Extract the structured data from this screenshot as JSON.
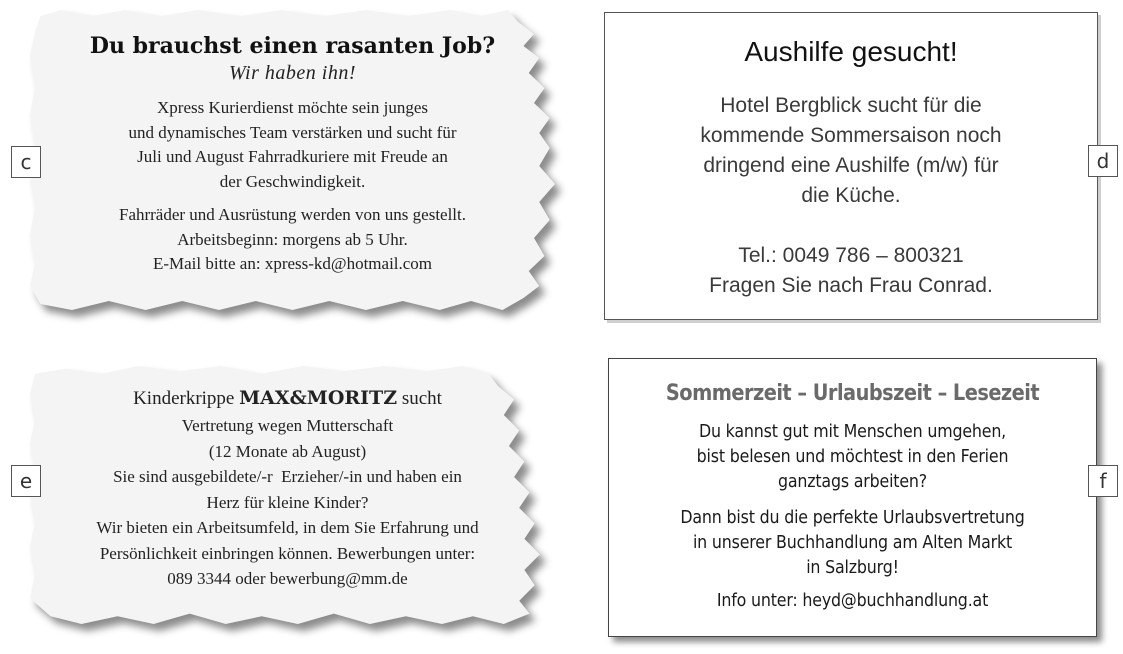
{
  "labels": {
    "c": "c",
    "d": "d",
    "e": "e",
    "f": "f"
  },
  "ad_c": {
    "title": "Du brauchst einen rasanten Job?",
    "subtitle": "Wir haben ihn!",
    "paragraph1": [
      "Xpress Kurierdienst möchte sein junges",
      "und dynamisches Team verstärken und sucht für",
      "Juli und August Fahrradkuriere mit Freude an",
      "der Geschwindigkeit."
    ],
    "paragraph2": [
      "Fahrräder und Ausrüstung werden von uns gestellt.",
      "Arbeitsbeginn: morgens ab 5 Uhr.",
      "E-Mail bitte an: xpress-kd@hotmail.com"
    ]
  },
  "ad_d": {
    "title": "Aushilfe gesucht!",
    "paragraph1": [
      "Hotel Bergblick sucht für die",
      "kommende Sommersaison noch",
      "dringend eine Aushilfe (m/w) für",
      "die Küche."
    ],
    "paragraph2": [
      "Tel.: 0049 786 – 800321",
      "Fragen Sie nach Frau Conrad."
    ]
  },
  "ad_e": {
    "head_prefix": "Kinderkrippe",
    "head_brand": "MAX&MORITZ",
    "head_suffix": "sucht",
    "lines": [
      "Vertretung wegen Mutterschaft",
      "(12 Monate ab August)",
      "Sie sind ausgebildete/-r  Erzieher/-in und haben ein",
      "Herz für kleine Kinder?",
      "Wir bieten ein Arbeitsumfeld, in dem Sie Erfahrung und",
      "Persönlichkeit einbringen können. Bewerbungen unter:",
      "089 3344 oder bewerbung@mm.de"
    ]
  },
  "ad_f": {
    "title": "Sommerzeit – Urlaubszeit – Lesezeit",
    "paragraph1": [
      "Du kannst gut mit Menschen umgehen,",
      "bist belesen und möchtest in den Ferien",
      "ganztags arbeiten?"
    ],
    "paragraph2": [
      "Dann bist du die perfekte Urlaubsvertretung",
      "in unserer Buchhandlung am Alten Markt",
      "in Salzburg!"
    ],
    "contact": "Info unter: heyd@buchhandlung.at"
  }
}
